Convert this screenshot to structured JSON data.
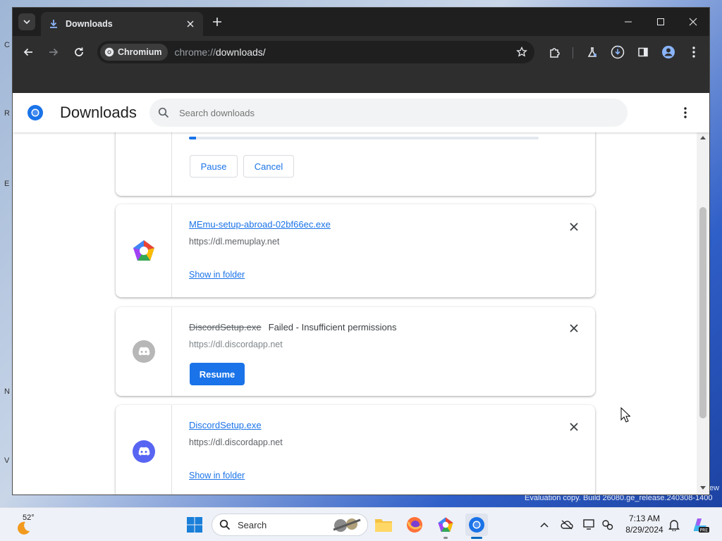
{
  "desktop": {
    "edge_letters": [
      "C",
      "R",
      "E",
      "N",
      "V"
    ],
    "evaluation_text": "Evaluation copy. Build 26080.ge_release.240308-1400",
    "edge_text": "ew"
  },
  "browser": {
    "tab": {
      "title": "Downloads"
    },
    "omnibox": {
      "chip_label": "Chromium",
      "url_scheme": "chrome://",
      "url_path": "downloads/"
    }
  },
  "downloads_page": {
    "title": "Downloads",
    "search_placeholder": "Search downloads",
    "items": [
      {
        "state": "in_progress",
        "progress": 0.02,
        "actions": {
          "pause": "Pause",
          "cancel": "Cancel"
        }
      },
      {
        "state": "complete",
        "icon": "memu-icon",
        "filename": "MEmu-setup-abroad-02bf66ec.exe",
        "source": "https://dl.memuplay.net",
        "action": "Show in folder"
      },
      {
        "state": "failed",
        "icon": "discord-icon",
        "filename": "DiscordSetup.exe",
        "status": "Failed - Insufficient permissions",
        "source": "https://dl.discordapp.net",
        "action": "Resume"
      },
      {
        "state": "complete",
        "icon": "discord-icon",
        "filename": "DiscordSetup.exe",
        "source": "https://dl.discordapp.net",
        "action": "Show in folder"
      }
    ]
  },
  "taskbar": {
    "weather_temp": "52°",
    "search_label": "Search",
    "time": "7:13 AM",
    "date": "8/29/2024"
  },
  "colors": {
    "accent": "#1a73e8",
    "browser_frame": "#1f1f1f",
    "toolbar": "#2e2e2e"
  }
}
